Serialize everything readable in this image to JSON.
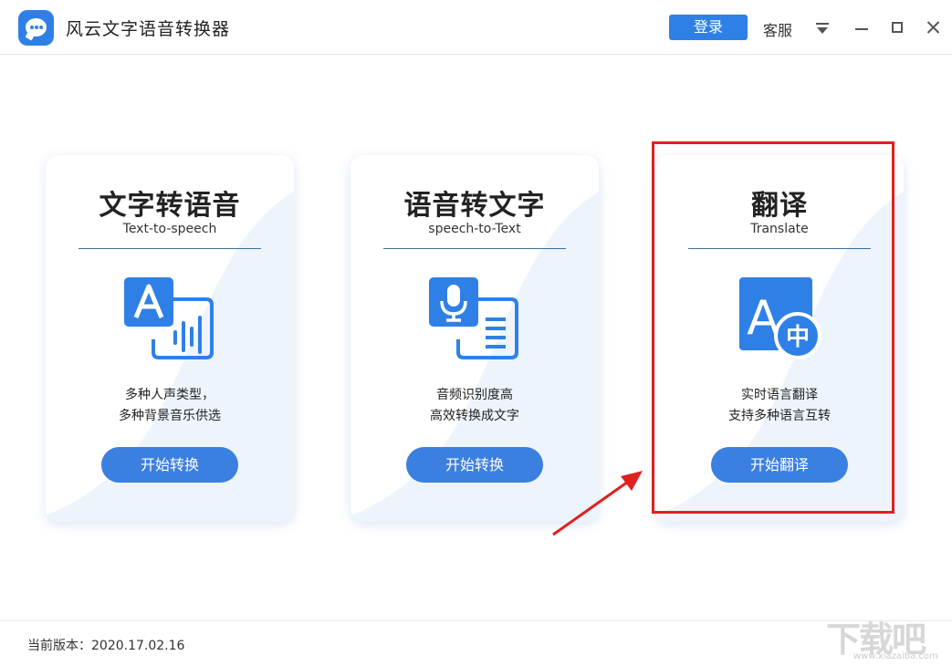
{
  "window": {
    "title": "风云文字语音转换器",
    "login_label": "登录",
    "service_label": "客服"
  },
  "cards": [
    {
      "title": "文字转语音",
      "subtitle": "Text-to-speech",
      "desc_line1": "多种人声类型，",
      "desc_line2": "多种背景音乐供选",
      "button_label": "开始转换",
      "icon": "text-to-speech-icon"
    },
    {
      "title": "语音转文字",
      "subtitle": "speech-to-Text",
      "desc_line1": "音频识别度高",
      "desc_line2": "高效转换成文字",
      "button_label": "开始转换",
      "icon": "speech-to-text-icon"
    },
    {
      "title": "翻译",
      "subtitle": "Translate",
      "desc_line1": "实时语言翻译",
      "desc_line2": "支持多种语言互转",
      "button_label": "开始翻译",
      "icon": "translate-icon",
      "icon_glyph_main": "A",
      "icon_glyph_sub": "中"
    }
  ],
  "footer": {
    "version_label": "当前版本：2020.17.02.16"
  },
  "watermark": {
    "text": "下载吧",
    "url": "www.xiazaiba.com"
  },
  "colors": {
    "accent": "#2f80e6",
    "button": "#3b7fe0",
    "highlight": "#e02020"
  }
}
